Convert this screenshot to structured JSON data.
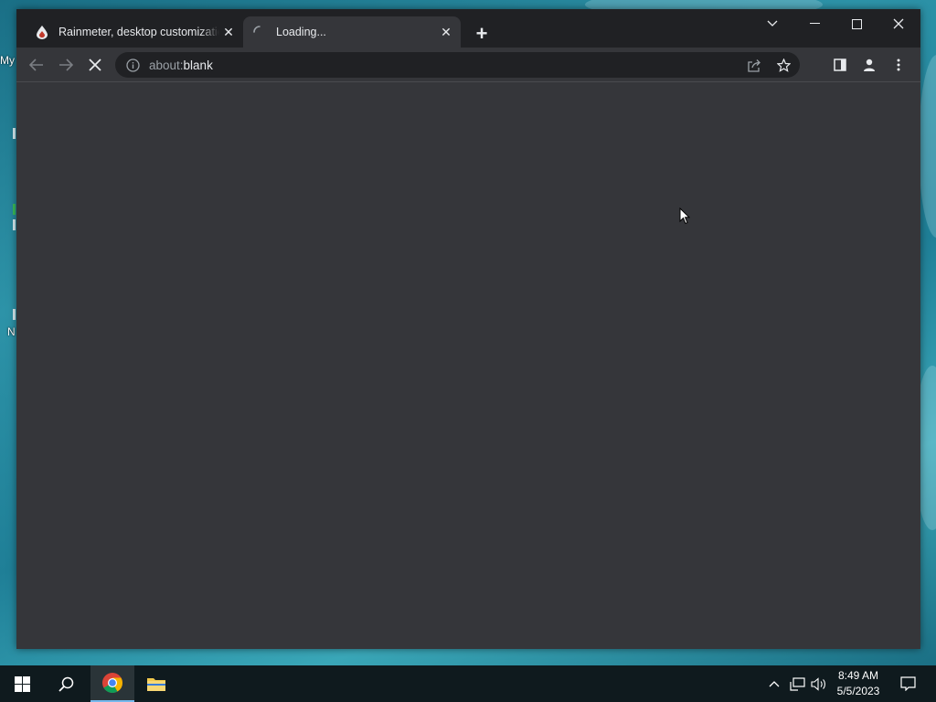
{
  "desktop": {
    "labels": [
      "My",
      "N"
    ]
  },
  "browser": {
    "tabs": [
      {
        "title": "Rainmeter, desktop customization tool",
        "favicon": "rainmeter-drop-icon",
        "active": false
      },
      {
        "title": "Loading...",
        "favicon": "loading-spinner-icon",
        "active": true
      }
    ],
    "address": {
      "scheme": "about:",
      "rest": "blank"
    },
    "colors": {
      "frame": "#202124",
      "toolbar": "#35363a",
      "page": "#35363a",
      "text": "#e8eaed"
    }
  },
  "taskbar": {
    "time": "8:49 AM",
    "date": "5/5/2023",
    "pinned": [
      "windows-start-icon",
      "search-icon",
      "chrome-icon",
      "file-explorer-icon"
    ]
  }
}
